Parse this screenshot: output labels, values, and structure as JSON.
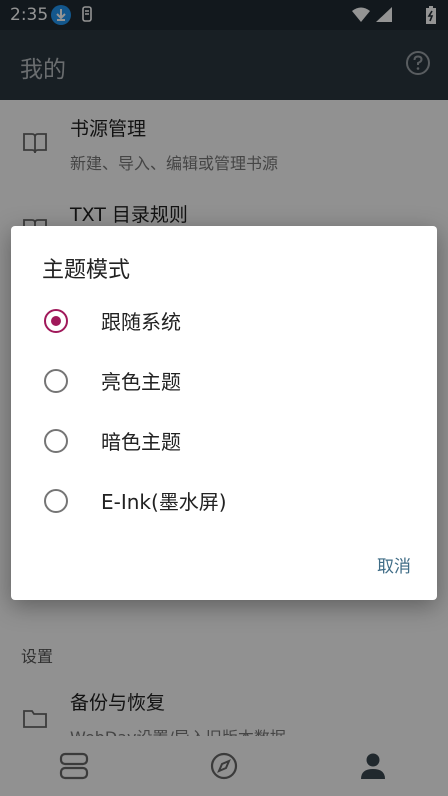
{
  "status_bar": {
    "time": "2:35",
    "download_icon": "download-icon",
    "nfc_icon": "nfc-icon",
    "wifi_icon": "wifi-icon",
    "signal_icon": "signal-icon",
    "battery_icon": "battery-charging-icon"
  },
  "app_bar": {
    "title": "我的",
    "help_icon": "help-circle-icon"
  },
  "background": {
    "items": [
      {
        "title": "书源管理",
        "subtitle": "新建、导入、编辑或管理书源",
        "icon": "book-icon"
      },
      {
        "title": "TXT 目录规则",
        "icon": "book-icon"
      },
      {
        "title": "备份与恢复",
        "subtitle": "WebDav设置/导入旧版本数据",
        "icon": "folder-icon"
      }
    ],
    "section_header": "设置"
  },
  "bottom_nav": {
    "items": [
      "bookshelf-icon",
      "compass-icon",
      "person-icon"
    ]
  },
  "dialog": {
    "title": "主题模式",
    "options": [
      {
        "label": "跟随系统",
        "checked": true
      },
      {
        "label": "亮色主题",
        "checked": false
      },
      {
        "label": "暗色主题",
        "checked": false
      },
      {
        "label": "E-Ink(墨水屏)",
        "checked": false
      }
    ],
    "cancel_label": "取消"
  },
  "colors": {
    "accent": "#a0185a",
    "app_bar": "#2a363f",
    "button_text": "#3f6c86"
  }
}
